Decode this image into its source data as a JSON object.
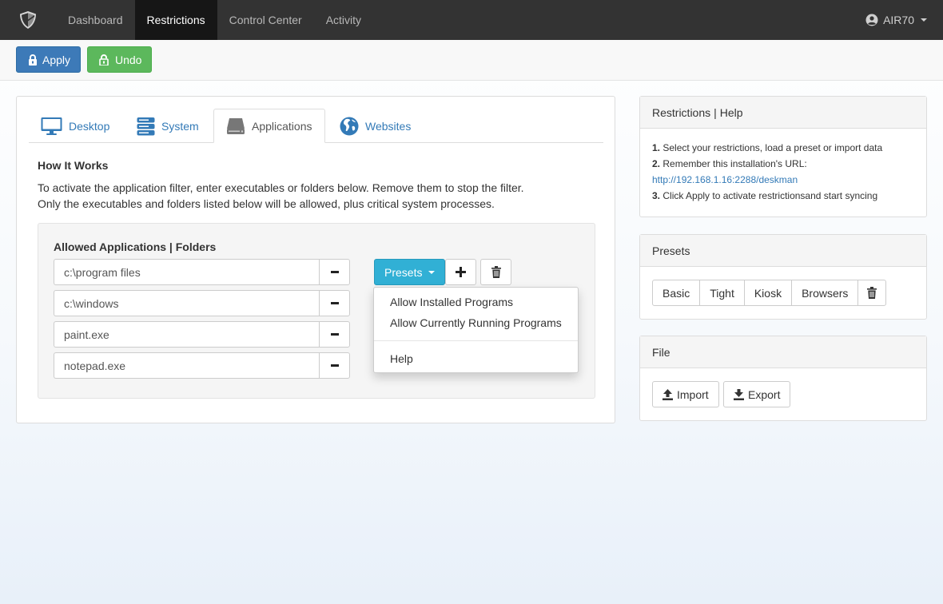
{
  "navbar": {
    "brand_icon": "shield-icon",
    "items": [
      {
        "label": "Dashboard",
        "active": false
      },
      {
        "label": "Restrictions",
        "active": true
      },
      {
        "label": "Control Center",
        "active": false
      },
      {
        "label": "Activity",
        "active": false
      }
    ],
    "user": {
      "name": "AIR70",
      "icon": "user-circle-icon"
    }
  },
  "toolbar": {
    "apply_label": "Apply",
    "undo_label": "Undo"
  },
  "tabs": [
    {
      "label": "Desktop",
      "icon": "monitor-icon",
      "active": false
    },
    {
      "label": "System",
      "icon": "server-icon",
      "active": false
    },
    {
      "label": "Applications",
      "icon": "hard-drive-icon",
      "active": true
    },
    {
      "label": "Websites",
      "icon": "globe-icon",
      "active": false
    }
  ],
  "how_it_works": {
    "title": "How It Works",
    "line1": "To activate the application filter, enter executables or folders below. Remove them to stop the filter.",
    "line2": "Only the executables and folders listed below will be allowed, plus critical system processes."
  },
  "allowed": {
    "title": "Allowed Applications | Folders",
    "entries": [
      "c:\\program files",
      "c:\\windows",
      "paint.exe",
      "notepad.exe"
    ],
    "presets_label": "Presets"
  },
  "presets_menu": {
    "items": [
      "Allow Installed Programs",
      "Allow Currently Running Programs"
    ],
    "help": "Help"
  },
  "help_panel": {
    "title_a": "Restrictions",
    "sep": "|",
    "title_b": "Help",
    "step1_num": "1.",
    "step1": "Select your restrictions, load a preset or import data",
    "step2_num": "2.",
    "step2": "Remember this installation's URL:",
    "url": "http://192.168.1.16:2288/deskman",
    "step3_num": "3.",
    "step3": "Click Apply to activate restrictionsand start syncing"
  },
  "presets_panel": {
    "title": "Presets",
    "buttons": [
      "Basic",
      "Tight",
      "Kiosk",
      "Browsers"
    ]
  },
  "file_panel": {
    "title": "File",
    "import_label": "Import",
    "export_label": "Export"
  },
  "colors": {
    "navbar": "#333333",
    "apply": "#3d7ab8",
    "undo": "#5cb85c",
    "presets": "#31b0d5",
    "link": "#337ab7"
  }
}
